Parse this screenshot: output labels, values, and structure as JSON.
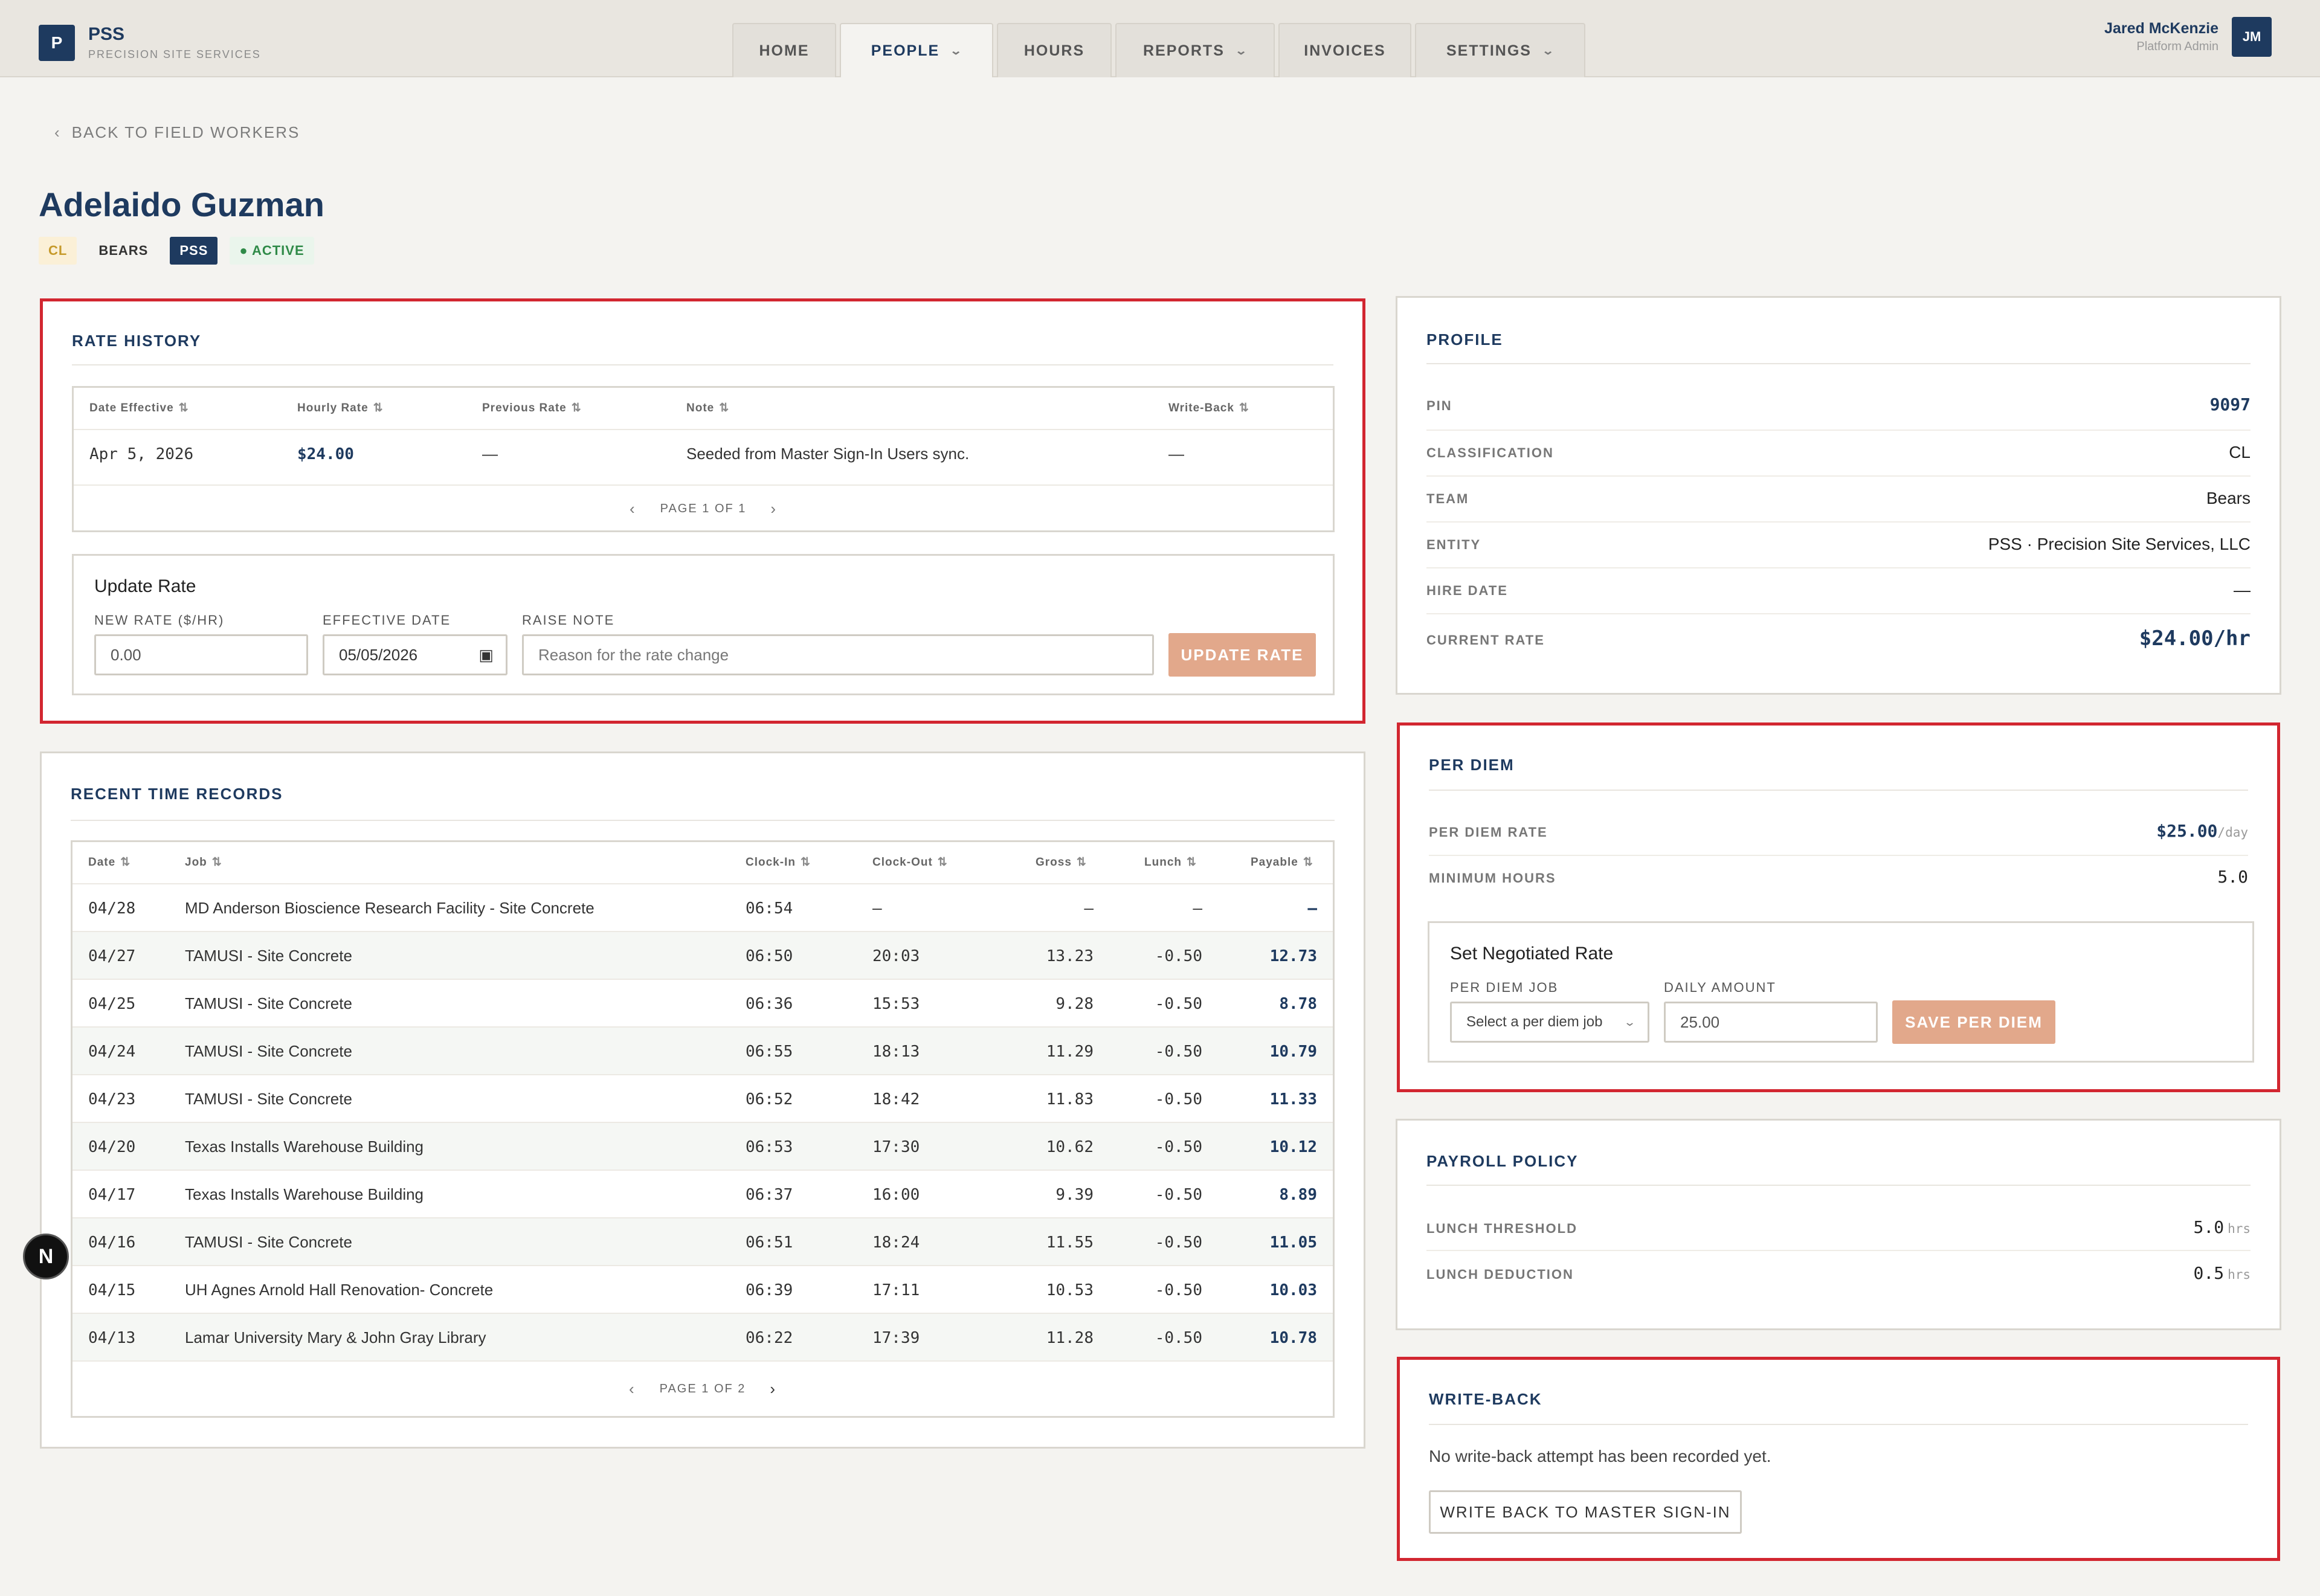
{
  "brand": {
    "logo": "P",
    "name": "PSS",
    "subtitle": "PRECISION SITE SERVICES"
  },
  "nav": {
    "tabs": [
      {
        "label": "HOME",
        "has_dropdown": false
      },
      {
        "label": "PEOPLE",
        "has_dropdown": true,
        "active": true
      },
      {
        "label": "HOURS",
        "has_dropdown": false
      },
      {
        "label": "REPORTS",
        "has_dropdown": true
      },
      {
        "label": "INVOICES",
        "has_dropdown": false
      },
      {
        "label": "SETTINGS",
        "has_dropdown": true
      }
    ]
  },
  "user": {
    "name": "Jared McKenzie",
    "role": "Platform Admin",
    "initials": "JM"
  },
  "back_link": "BACK TO FIELD WORKERS",
  "worker": {
    "name": "Adelaido Guzman",
    "tags": {
      "classification": "CL",
      "team": "BEARS",
      "entity": "PSS",
      "status": "ACTIVE"
    }
  },
  "rate_history": {
    "title": "RATE HISTORY",
    "columns": [
      "Date Effective",
      "Hourly Rate",
      "Previous Rate",
      "Note",
      "Write-Back"
    ],
    "rows": [
      {
        "date": "Apr 5, 2026",
        "rate": "$24.00",
        "previous": "—",
        "note": "Seeded from Master Sign-In Users sync.",
        "writeback": "—"
      }
    ],
    "pager": "PAGE 1 OF 1"
  },
  "update_rate": {
    "title": "Update Rate",
    "new_rate_label": "NEW RATE ($/HR)",
    "new_rate_value": "0.00",
    "effective_date_label": "EFFECTIVE DATE",
    "effective_date_value": "05/05/2026",
    "note_label": "RAISE NOTE",
    "note_placeholder": "Reason for the rate change",
    "button": "UPDATE RATE"
  },
  "time_records": {
    "title": "RECENT TIME RECORDS",
    "columns": [
      "Date",
      "Job",
      "Clock-In",
      "Clock-Out",
      "Gross",
      "Lunch",
      "Payable"
    ],
    "rows": [
      {
        "date": "04/28",
        "job": "MD Anderson Bioscience Research Facility - Site Concrete",
        "in": "06:54",
        "out": "—",
        "gross": "—",
        "lunch": "—",
        "payable": "—"
      },
      {
        "date": "04/27",
        "job": "TAMUSI - Site Concrete",
        "in": "06:50",
        "out": "20:03",
        "gross": "13.23",
        "lunch": "-0.50",
        "payable": "12.73"
      },
      {
        "date": "04/25",
        "job": "TAMUSI - Site Concrete",
        "in": "06:36",
        "out": "15:53",
        "gross": "9.28",
        "lunch": "-0.50",
        "payable": "8.78"
      },
      {
        "date": "04/24",
        "job": "TAMUSI - Site Concrete",
        "in": "06:55",
        "out": "18:13",
        "gross": "11.29",
        "lunch": "-0.50",
        "payable": "10.79"
      },
      {
        "date": "04/23",
        "job": "TAMUSI - Site Concrete",
        "in": "06:52",
        "out": "18:42",
        "gross": "11.83",
        "lunch": "-0.50",
        "payable": "11.33"
      },
      {
        "date": "04/20",
        "job": "Texas Installs Warehouse Building",
        "in": "06:53",
        "out": "17:30",
        "gross": "10.62",
        "lunch": "-0.50",
        "payable": "10.12"
      },
      {
        "date": "04/17",
        "job": "Texas Installs Warehouse Building",
        "in": "06:37",
        "out": "16:00",
        "gross": "9.39",
        "lunch": "-0.50",
        "payable": "8.89"
      },
      {
        "date": "04/16",
        "job": "TAMUSI - Site Concrete",
        "in": "06:51",
        "out": "18:24",
        "gross": "11.55",
        "lunch": "-0.50",
        "payable": "11.05"
      },
      {
        "date": "04/15",
        "job": "UH Agnes Arnold Hall Renovation- Concrete",
        "in": "06:39",
        "out": "17:11",
        "gross": "10.53",
        "lunch": "-0.50",
        "payable": "10.03"
      },
      {
        "date": "04/13",
        "job": "Lamar University Mary & John Gray Library",
        "in": "06:22",
        "out": "17:39",
        "gross": "11.28",
        "lunch": "-0.50",
        "payable": "10.78"
      }
    ],
    "pager": "PAGE 1 OF 2"
  },
  "profile": {
    "title": "PROFILE",
    "fields": [
      {
        "label": "PIN",
        "value": "9097"
      },
      {
        "label": "CLASSIFICATION",
        "value": "CL"
      },
      {
        "label": "TEAM",
        "value": "Bears"
      },
      {
        "label": "ENTITY",
        "value": "PSS · Precision Site Services, LLC"
      },
      {
        "label": "HIRE DATE",
        "value": "—"
      },
      {
        "label": "CURRENT RATE",
        "value": "$24.00/hr"
      }
    ]
  },
  "per_diem": {
    "title": "PER DIEM",
    "rate_label": "PER DIEM RATE",
    "rate_value": "$25.00",
    "rate_unit": "/day",
    "min_hours_label": "MINIMUM HOURS",
    "min_hours_value": "5.0",
    "form_title": "Set Negotiated Rate",
    "job_label": "PER DIEM JOB",
    "job_value": "Select a per diem job",
    "amount_label": "DAILY AMOUNT",
    "amount_value": "25.00",
    "button": "SAVE PER DIEM"
  },
  "payroll_policy": {
    "title": "PAYROLL POLICY",
    "lunch_threshold_label": "LUNCH THRESHOLD",
    "lunch_threshold_value": "5.0",
    "lunch_deduction_label": "LUNCH DEDUCTION",
    "lunch_deduction_value": "0.5",
    "unit": "hrs"
  },
  "write_back": {
    "title": "WRITE-BACK",
    "message": "No write-back attempt has been recorded yet.",
    "button": "WRITE BACK TO MASTER SIGN-IN"
  },
  "fab": {
    "label": "N"
  },
  "colors": {
    "brand": "#1e3a5f",
    "highlight": "#d22630",
    "button": "#e2a88b",
    "active": "#2f8a48"
  }
}
